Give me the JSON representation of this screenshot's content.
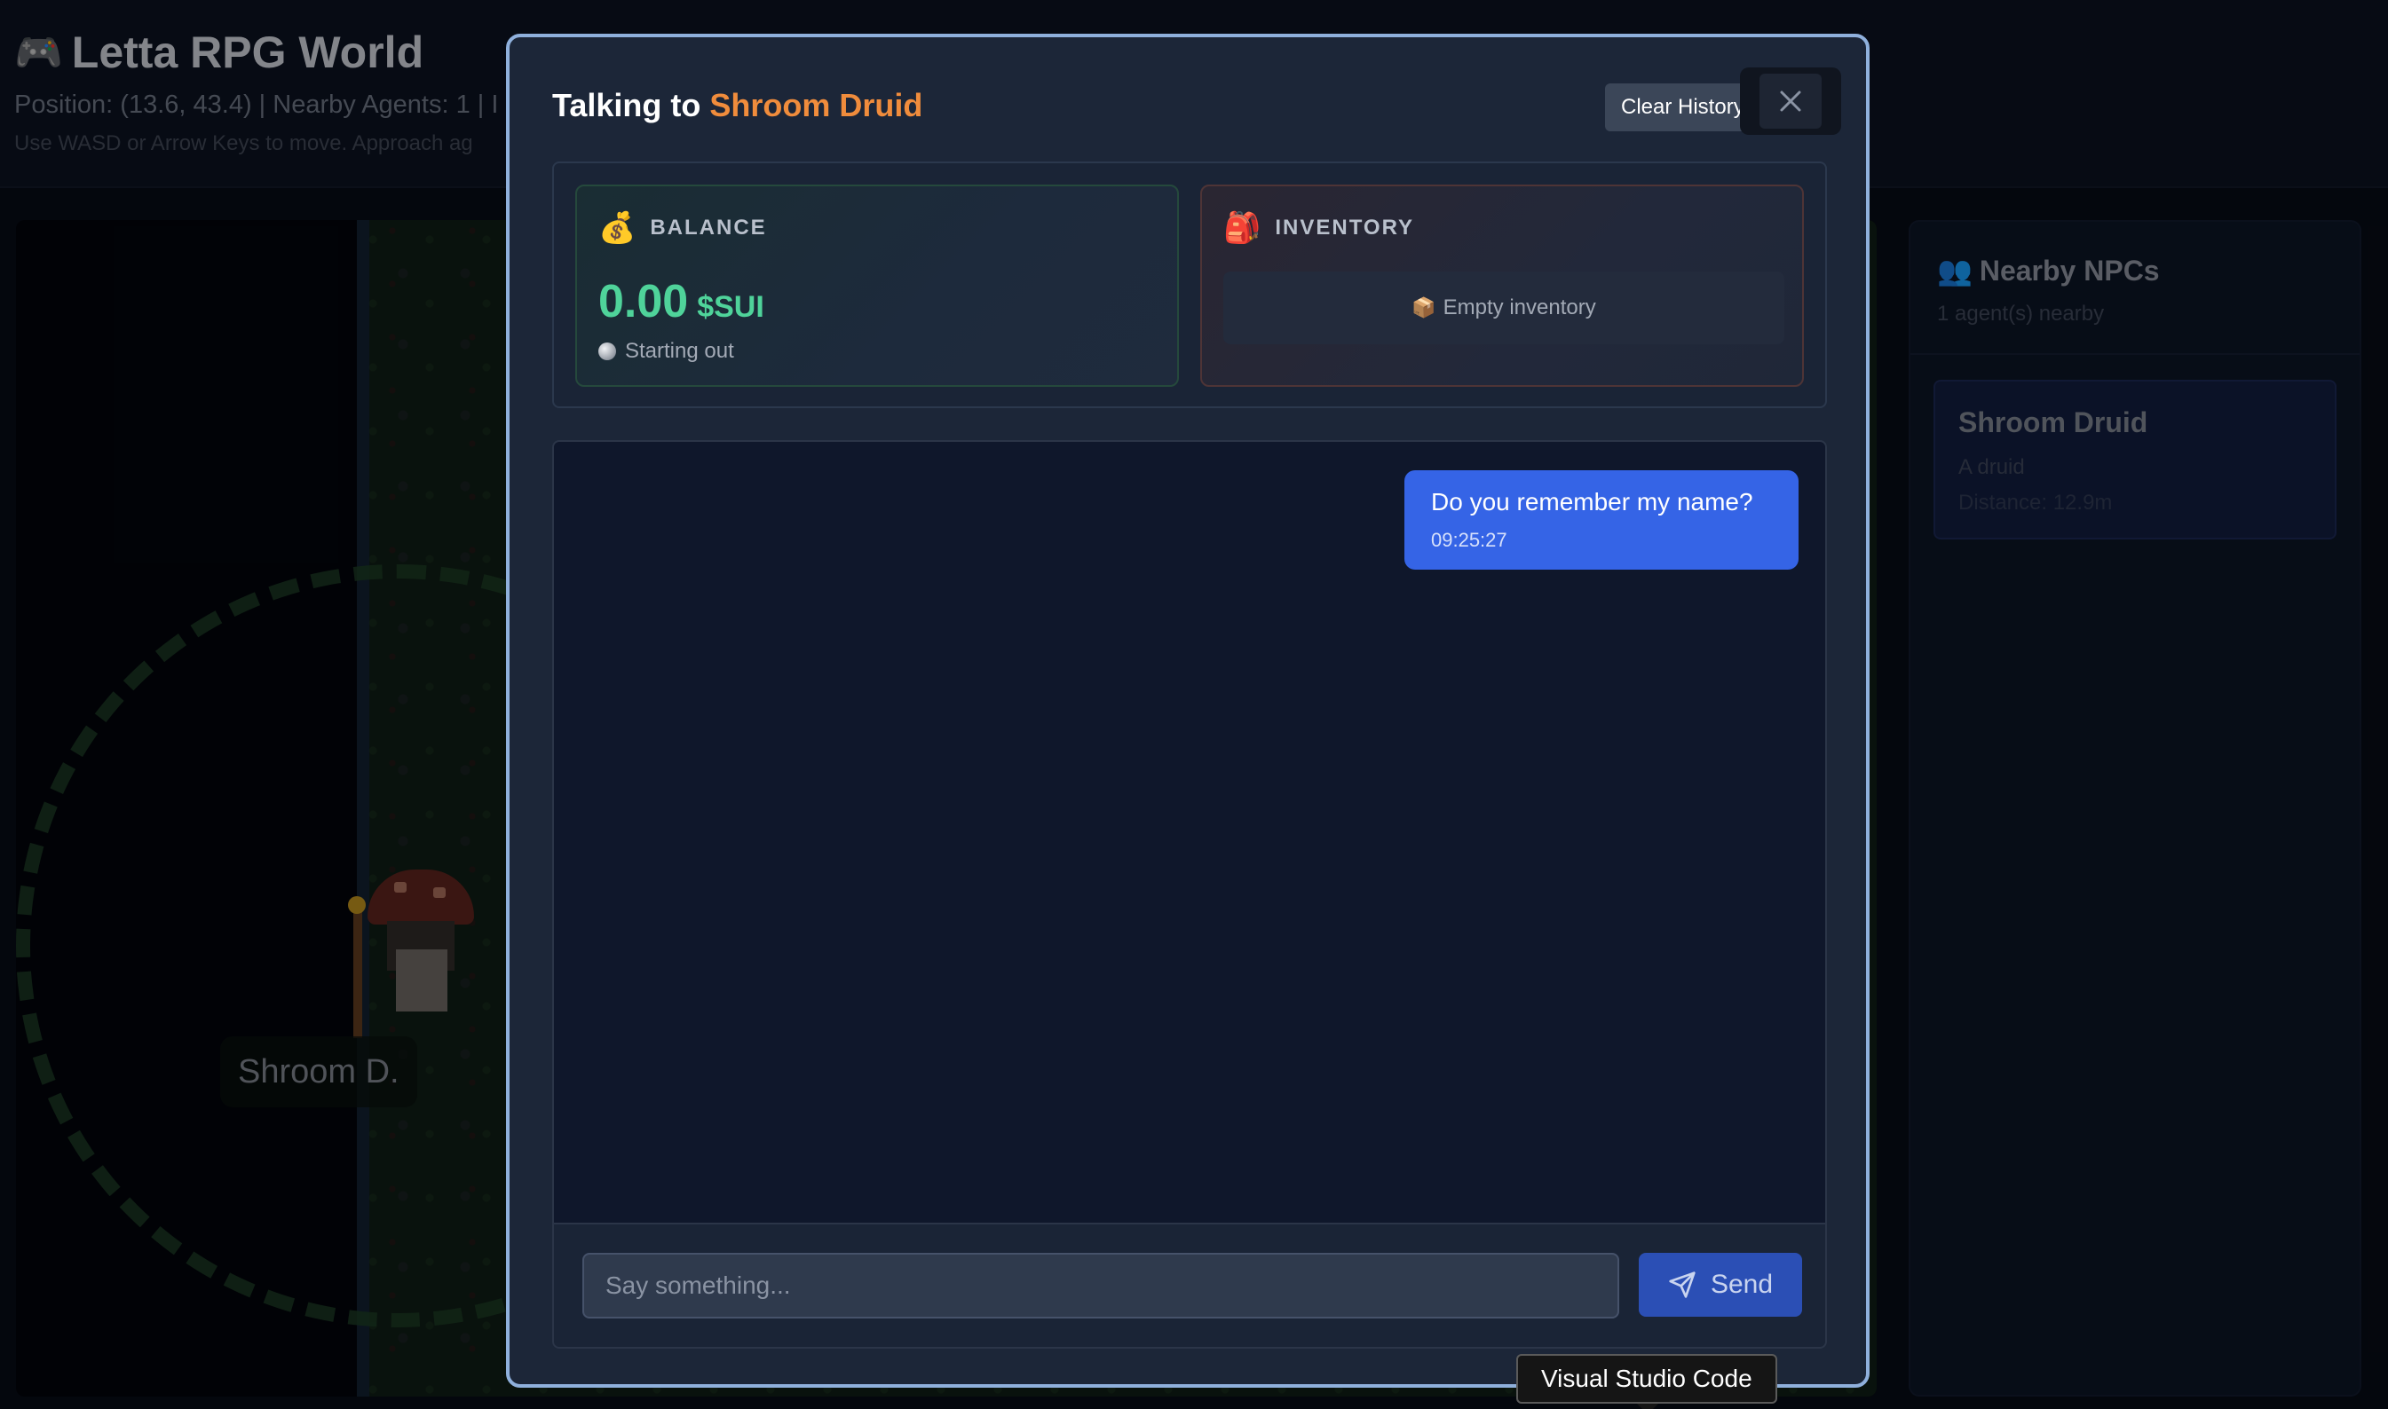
{
  "background": {
    "title": "Letta RPG World",
    "title_icon": "gamepad-icon",
    "position_text": "Position: (13.6, 43.4) | Nearby Agents: 1 | I",
    "help_text": "Use WASD or Arrow Keys to move. Approach ag",
    "npc_label": "Shroom D.",
    "nearby_panel": {
      "title": "Nearby NPCs",
      "title_icon": "people-icon",
      "subtitle": "1 agent(s) nearby",
      "npcs": [
        {
          "name": "Shroom Druid",
          "description": "A druid",
          "distance": "Distance: 12.9m"
        }
      ]
    }
  },
  "modal": {
    "title_prefix": "Talking to",
    "npc_name": "Shroom Druid",
    "clear_history_label": "Clear History",
    "balance": {
      "icon": "money-bag-icon",
      "label": "BALANCE",
      "amount": "0.00",
      "currency": "$SUI",
      "status": "Starting out"
    },
    "inventory": {
      "icon": "backpack-icon",
      "label": "INVENTORY",
      "empty_text": "Empty inventory"
    },
    "messages": [
      {
        "role": "user",
        "text": "Do you remember my name?",
        "time": "09:25:27"
      }
    ],
    "input": {
      "placeholder": "Say something...",
      "value": ""
    },
    "send_label": "Send"
  },
  "tooltip": "Visual Studio Code",
  "colors": {
    "accent_blue": "#3564e6",
    "npc_name_orange": "#f08c3c",
    "balance_green": "#4fd39a",
    "modal_border": "#8fb0dc"
  }
}
